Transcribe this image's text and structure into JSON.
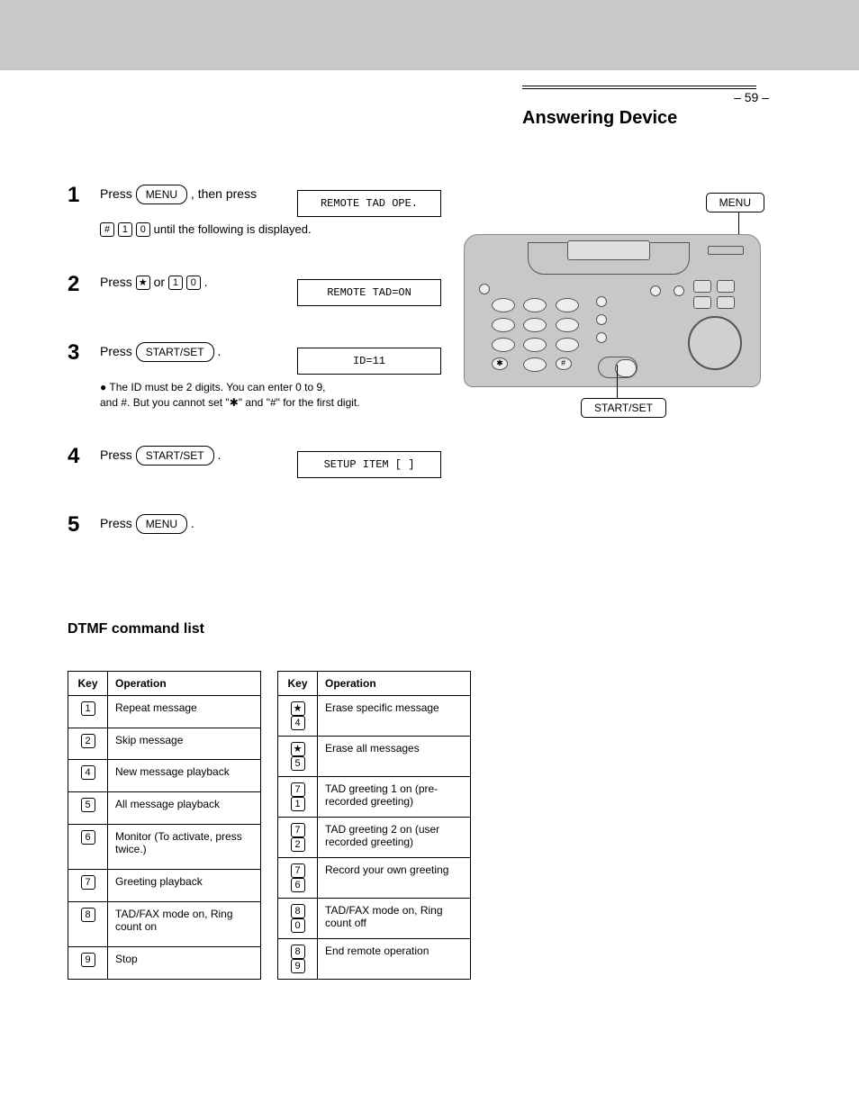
{
  "pageNumber": "– 59 –",
  "sectionTitle": "Answering Device",
  "topBand": {},
  "steps": [
    {
      "num": "1",
      "preText": "Press",
      "btn": "MENU",
      "postText": ", then press",
      "keys": [],
      "tailKeys": [
        "#",
        "1",
        "0"
      ],
      "afterTail": "until the following is displayed.",
      "display": "REMOTE TAD OPE."
    },
    {
      "num": "2",
      "preText": "Press",
      "btn": "",
      "keys": [],
      "plainBefore": true,
      "afterTail": "",
      "display": "REMOTE TAD=ON",
      "footerSmall": "",
      "inlineKeys": [
        "★",
        "1",
        "0"
      ],
      "tailPlain": "."
    },
    {
      "num": "3",
      "preText": "Press",
      "btn": "START/SET",
      "postText": ".",
      "display": "ID=11",
      "footerSmall": "",
      "continueLine": "● The ID must be 2 digits. You can enter 0 to 9,",
      "continueTiny": " and #. But you cannot set \"✱\" and \"#\" for the first digit."
    },
    {
      "num": "4",
      "preText": "Press",
      "btn": "START/SET",
      "postText": ".",
      "display": "SETUP ITEM [  ]"
    },
    {
      "num": "5",
      "preText": "Press",
      "btn": "MENU",
      "postText": "."
    }
  ],
  "panel": {
    "calloutTop": "MENU",
    "calloutBottom": "START/SET"
  },
  "subHeading": "DTMF command list",
  "table1": {
    "headers": [
      "Key",
      "Operation"
    ],
    "rows": [
      {
        "key": "1",
        "op": "Repeat message"
      },
      {
        "key": "2",
        "op": "Skip message"
      },
      {
        "key": "4",
        "op": "New message playback"
      },
      {
        "key": "5",
        "op": "All message playback"
      },
      {
        "key": "6",
        "op": "Monitor (To activate, press twice.)"
      },
      {
        "key": "7",
        "op": "Greeting playback"
      },
      {
        "key": "8",
        "op": "TAD/FAX mode on, Ring count on"
      },
      {
        "key": "9",
        "op": "Stop"
      }
    ]
  },
  "table2": {
    "headers": [
      "Key",
      "Operation"
    ],
    "rows": [
      {
        "keys": [
          "★",
          "4"
        ],
        "op": "Erase specific message"
      },
      {
        "keys": [
          "★",
          "5"
        ],
        "op": "Erase all messages"
      },
      {
        "keys": [
          "7",
          "1"
        ],
        "op": "TAD greeting 1 on (pre-recorded greeting)"
      },
      {
        "keys": [
          "7",
          "2"
        ],
        "op": "TAD greeting 2 on (user recorded greeting)"
      },
      {
        "keys": [
          "7",
          "6"
        ],
        "op": "Record your own greeting"
      },
      {
        "keys": [
          "8",
          "0"
        ],
        "op": "TAD/FAX mode on, Ring count off"
      },
      {
        "keys": [
          "8",
          "9"
        ],
        "op": "End remote operation"
      }
    ]
  }
}
